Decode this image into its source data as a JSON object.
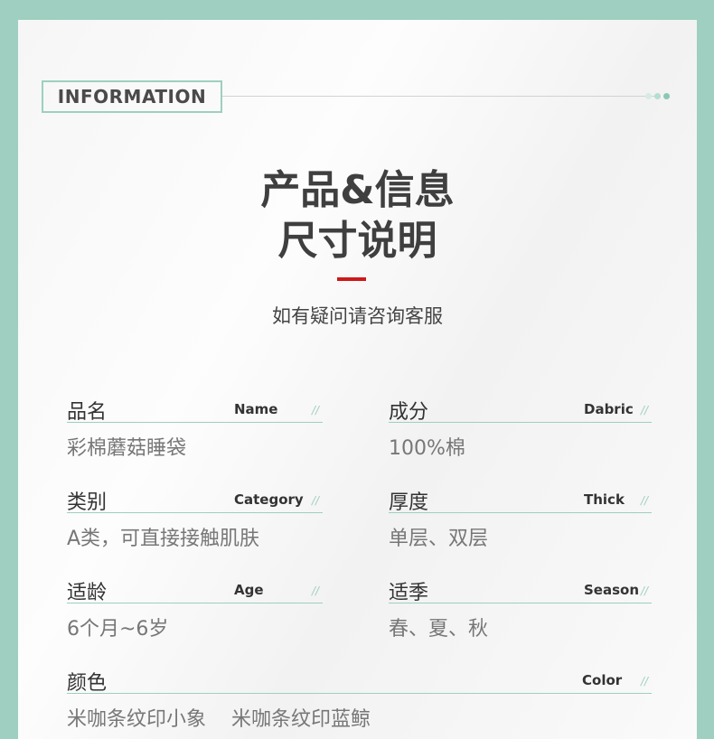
{
  "header": {
    "info_label": "INFORMATION",
    "title_line1": "产品&信息",
    "title_line2": "尺寸说明",
    "subtitle": "如有疑问请咨询客服"
  },
  "colors": {
    "frame": "#9ecfc0",
    "accent_red": "#cc1a1a",
    "dot_light": "#d6ebe5",
    "dot_mid": "#b5ddd1",
    "dot_dark": "#8cc7b6"
  },
  "fields": {
    "name": {
      "cn": "品名",
      "en": "Name",
      "value": "彩棉蘑菇睡袋"
    },
    "fabric": {
      "cn": "成分",
      "en": "Dabric",
      "value": "100%棉"
    },
    "category": {
      "cn": "类别",
      "en": "Category",
      "value": "A类，可直接接触肌肤"
    },
    "thick": {
      "cn": "厚度",
      "en": "Thick",
      "value": "单层、双层"
    },
    "age": {
      "cn": "适龄",
      "en": "Age",
      "value": "6个月~6岁"
    },
    "season": {
      "cn": "适季",
      "en": "Season",
      "value": "春、夏、秋"
    },
    "color": {
      "cn": "颜色",
      "en": "Color",
      "value": "米咖条纹印小象    米咖条纹印蓝鲸"
    }
  },
  "slash_mark": "//"
}
